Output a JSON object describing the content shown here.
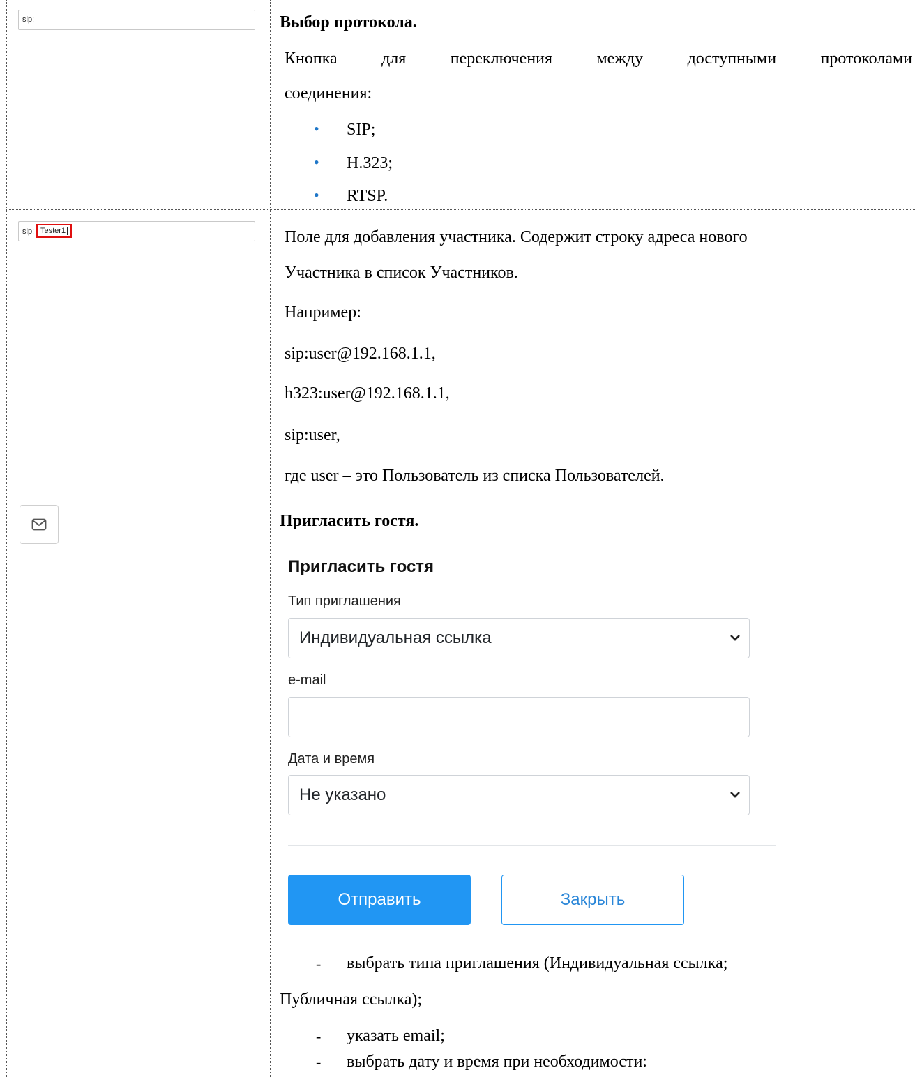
{
  "row1": {
    "sip_field_value": "sip:",
    "title": "Выбор протокола.",
    "desc_line1": "Кнопка для переключения между доступными протоколами",
    "desc_line2": "соединения:",
    "protocols": [
      "SIP;",
      "H.323;",
      "RTSP."
    ]
  },
  "row2": {
    "sip_prefix": "sip:",
    "sip_value": "Tester1",
    "desc_line1": "Поле для добавления участника. Содержит строку адреса нового",
    "desc_line2": "Участника в список Участников.",
    "example_label": "Например:",
    "examples": [
      "sip:user@192.168.1.1,",
      "h323:user@192.168.1.1,",
      "sip:user,"
    ],
    "note": "где user – это Пользователь из списка Пользователей."
  },
  "row3": {
    "icon": "envelope-icon",
    "title": "Пригласить гостя.",
    "dialog": {
      "heading": "Пригласить гостя",
      "invite_type_label": "Тип приглашения",
      "invite_type_value": "Индивидуальная ссылка",
      "email_label": "e-mail",
      "email_value": "",
      "datetime_label": "Дата и время",
      "datetime_value": "Не указано",
      "send_label": "Отправить",
      "close_label": "Закрыть",
      "accent_color": "#2196f3"
    },
    "step1_dash": "-",
    "step1_a": "выбрать типа приглашения (Индивидуальная ссылка;",
    "step1_b": "Публичная ссылка);",
    "step2_dash": "-",
    "step2": "указать email;",
    "step3_dash": "-",
    "step3": "выбрать дату и время при необходимости:"
  }
}
